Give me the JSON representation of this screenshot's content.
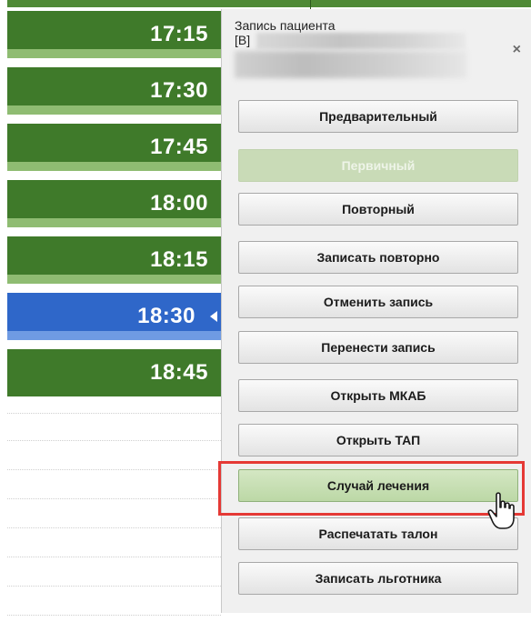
{
  "schedule": {
    "slots": [
      {
        "time": "17:15",
        "selected": false
      },
      {
        "time": "17:30",
        "selected": false
      },
      {
        "time": "17:45",
        "selected": false
      },
      {
        "time": "18:00",
        "selected": false
      },
      {
        "time": "18:15",
        "selected": false
      },
      {
        "time": "18:30",
        "selected": true
      },
      {
        "time": "18:45",
        "selected": false
      }
    ]
  },
  "popup": {
    "title": "Запись пациента",
    "patient_prefix": "[В]",
    "close_symbol": "×",
    "buttons": [
      {
        "label": "Предварительный",
        "state": "normal"
      },
      {
        "label": "Первичный",
        "state": "disabled"
      },
      {
        "label": "Повторный",
        "state": "normal"
      },
      {
        "label": "Записать повторно",
        "state": "normal"
      },
      {
        "label": "Отменить запись",
        "state": "normal"
      },
      {
        "label": "Перенести запись",
        "state": "normal"
      },
      {
        "label": "Открыть МКАБ",
        "state": "normal"
      },
      {
        "label": "Открыть ТАП",
        "state": "normal"
      },
      {
        "label": "Случай лечения",
        "state": "hover-highlighted"
      },
      {
        "label": "Распечатать талон",
        "state": "normal"
      },
      {
        "label": "Записать льготника",
        "state": "normal"
      }
    ]
  },
  "colors": {
    "slot_green": "#3f7a2a",
    "slot_separator": "#8fbc72",
    "slot_selected": "#2f67c9",
    "highlight_red": "#e53935"
  }
}
